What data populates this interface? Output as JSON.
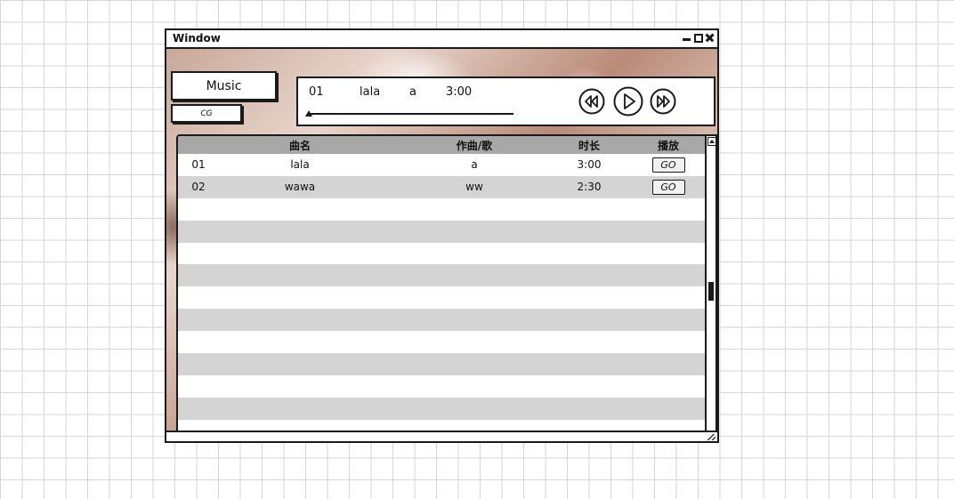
{
  "window": {
    "title": "Window",
    "controls": [
      "minimize-icon",
      "maximize-icon",
      "close-icon"
    ]
  },
  "tabs": {
    "music_label": "Music",
    "cg_label": "CG"
  },
  "now_playing": {
    "number": "01",
    "title": "lala",
    "artist": "a",
    "duration": "3:00",
    "progress_fraction": 0.0,
    "controls": [
      "rewind-icon",
      "play-icon",
      "fast-forward-icon"
    ]
  },
  "table": {
    "headers": {
      "title": "曲名",
      "artist": "作曲/歌",
      "length": "时长",
      "play": "播放"
    },
    "rows": [
      {
        "no": "01",
        "title": "lala",
        "artist": "a",
        "length": "3:00",
        "action": "GO"
      },
      {
        "no": "02",
        "title": "wawa",
        "artist": "ww",
        "length": "2:30",
        "action": "GO"
      }
    ],
    "empty_rows": 11
  },
  "scrollbar": {
    "position_fraction": 0.5
  },
  "colors": {
    "header_bg": "#a8a8a8",
    "stripe": "#d4d4d4",
    "outline": "#1a1a1a"
  }
}
